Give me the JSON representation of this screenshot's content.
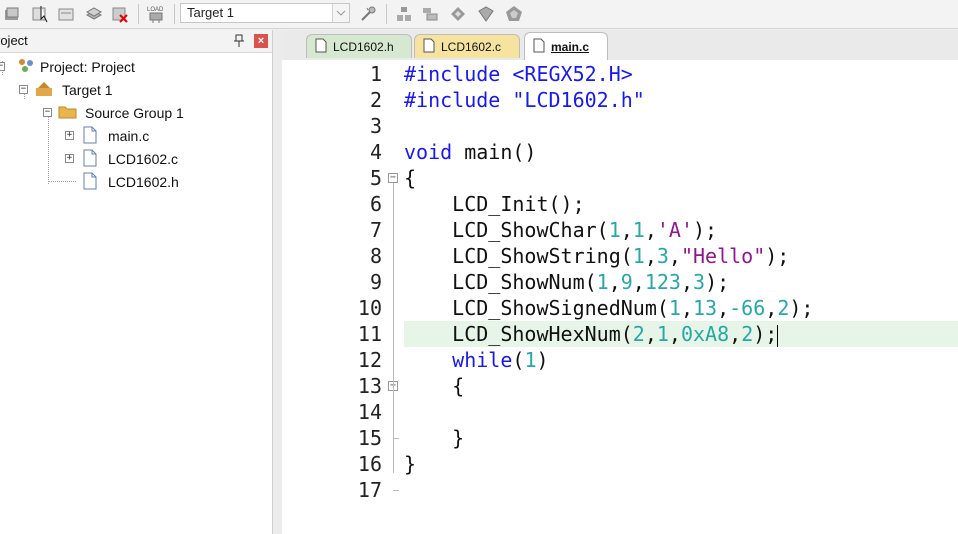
{
  "toolbar": {
    "target_label": "Target 1",
    "load_label": "LOAD",
    "icons": [
      "translate-icon",
      "build-icon",
      "rebuild-icon",
      "batch-build-icon",
      "stop-build-icon",
      "download-icon",
      "target-options-icon",
      "manage-project-icon",
      "file-extensions-icon",
      "manage-packs-icon",
      "select-packs-icon",
      "manage-rte-icon"
    ]
  },
  "project_panel": {
    "title": "roject",
    "tree": [
      {
        "label": "Project: Project",
        "level": 0,
        "icon": "project-icon"
      },
      {
        "label": "Target 1",
        "level": 1,
        "icon": "target-icon"
      },
      {
        "label": "Source Group 1",
        "level": 2,
        "icon": "folder-icon"
      },
      {
        "label": "main.c",
        "level": 3,
        "icon": "file-icon"
      },
      {
        "label": "LCD1602.c",
        "level": 3,
        "icon": "file-icon"
      },
      {
        "label": "LCD1602.h",
        "level": 3,
        "icon": "file-icon"
      }
    ]
  },
  "tabs": [
    {
      "label": "LCD1602.h",
      "active": false,
      "color": "#d6e8d0"
    },
    {
      "label": "LCD1602.c",
      "active": false,
      "color": "#f6e3a0"
    },
    {
      "label": "main.c",
      "active": true,
      "color": "#ffffff"
    }
  ],
  "editor": {
    "highlight_line": 11,
    "lines": [
      {
        "n": "1",
        "text": "#include <REGX52.H>"
      },
      {
        "n": "2",
        "text": "#include \"LCD1602.h\""
      },
      {
        "n": "3",
        "text": ""
      },
      {
        "n": "4",
        "text": "void main()"
      },
      {
        "n": "5",
        "text": "{"
      },
      {
        "n": "6",
        "text": "    LCD_Init();"
      },
      {
        "n": "7",
        "text": "    LCD_ShowChar(1,1,'A');"
      },
      {
        "n": "8",
        "text": "    LCD_ShowString(1,3,\"Hello\");"
      },
      {
        "n": "9",
        "text": "    LCD_ShowNum(1,9,123,3);"
      },
      {
        "n": "10",
        "text": "    LCD_ShowSignedNum(1,13,-66,2);"
      },
      {
        "n": "11",
        "text": "    LCD_ShowHexNum(2,1,0xA8,2);"
      },
      {
        "n": "12",
        "text": "    while(1)"
      },
      {
        "n": "13",
        "text": "    {"
      },
      {
        "n": "14",
        "text": "    "
      },
      {
        "n": "15",
        "text": "    }"
      },
      {
        "n": "16",
        "text": "}"
      },
      {
        "n": "17",
        "text": ""
      }
    ]
  },
  "colors": {
    "keyword": "#1a1ae6",
    "number": "#2aa6a6",
    "string": "#8b1a8b",
    "current_line": "#e6f5e8"
  }
}
